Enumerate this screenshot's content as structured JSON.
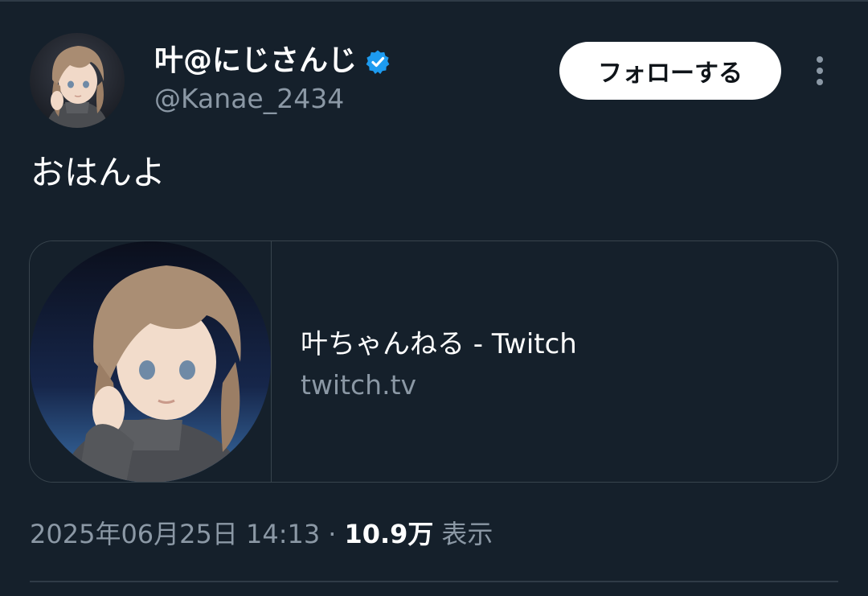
{
  "tweet": {
    "author": {
      "display_name": "叶@にじさんじ",
      "handle": "@Kanae_2434",
      "verified": true,
      "verified_icon": "verified-badge-icon",
      "verified_color": "#1d9bf0"
    },
    "follow_label": "フォローする",
    "more_icon": "more-vertical-icon",
    "text": "おはんよ",
    "card": {
      "title": "叶ちゃんねる - Twitch",
      "domain": "twitch.tv"
    },
    "meta": {
      "timestamp": "2025年06月25日 14:13",
      "separator": "·",
      "views_count": "10.9万",
      "views_label": "表示"
    }
  },
  "colors": {
    "background": "#15202b",
    "secondary_text": "#8b98a5",
    "border": "#38444d"
  }
}
